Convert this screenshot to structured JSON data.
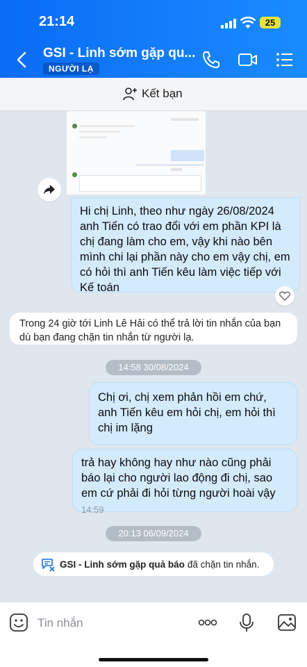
{
  "status_bar": {
    "time": "21:14",
    "battery": "25"
  },
  "header": {
    "title": "GSI - Linh sớm gặp qu...",
    "badge": "NGƯỜI LẠ",
    "icons": [
      "back-arrow",
      "phone-icon",
      "video-icon",
      "menu-list-icon"
    ]
  },
  "friend_bar": {
    "label": "Kết bạn"
  },
  "messages": {
    "msg1": "Hi chị Linh, theo như ngày 26/08/2024 anh Tiến có trao đổi với em phần KPI là chị đang làm cho em, vậy khi nào bên mình chi lại phần này cho em vậy chị, em có hỏi thì anh Tiến kêu làm việc tiếp với Kế toán",
    "system_note": "Trong 24 giờ tới Linh Lê Hải có thể trả lời tin nhắn của bạn dù bạn đang chặn tin nhắn từ người lạ.",
    "timestamp1": "14:58 30/08/2024",
    "msg2": "Chị ơi, chị xem phản hồi em chứ, anh Tiến kêu em hỏi chị, em hỏi thì chị im lặng",
    "msg3": "trả hay không hay như nào cũng phải báo lại cho người lao động đi chị, sao em cứ phải đi hỏi từng người hoài vậy",
    "msg3_time": "14:59",
    "timestamp2": "20:13 06/09/2024",
    "block_name": "GSI - Linh sớm gặp quả báo",
    "block_text": "đã chặn tin nhắn."
  },
  "input_bar": {
    "placeholder": "Tin nhắn",
    "more": "ooo"
  },
  "colors": {
    "header_start": "#0a6cf5",
    "header_end": "#1a8bff",
    "my_bubble": "#d4ebfd",
    "chat_bg": "#dfe6ee"
  }
}
